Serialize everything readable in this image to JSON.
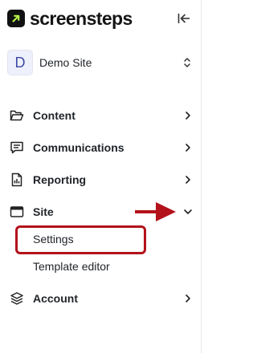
{
  "brand": {
    "name": "screensteps",
    "accent": "#b8f24a"
  },
  "site_selector": {
    "initial": "D",
    "name": "Demo Site"
  },
  "nav": {
    "content": {
      "label": "Content",
      "icon": "folder-open-icon"
    },
    "communications": {
      "label": "Communications",
      "icon": "message-square-icon"
    },
    "reporting": {
      "label": "Reporting",
      "icon": "report-document-icon"
    },
    "site": {
      "label": "Site",
      "icon": "browser-window-icon",
      "expanded": true,
      "children": [
        {
          "label": "Settings",
          "highlighted": true
        },
        {
          "label": "Template editor"
        }
      ]
    },
    "account": {
      "label": "Account",
      "icon": "layers-icon"
    }
  },
  "annotation": {
    "color": "#b3121b",
    "arrow_target": "site-chevron",
    "box_target": "Settings"
  }
}
